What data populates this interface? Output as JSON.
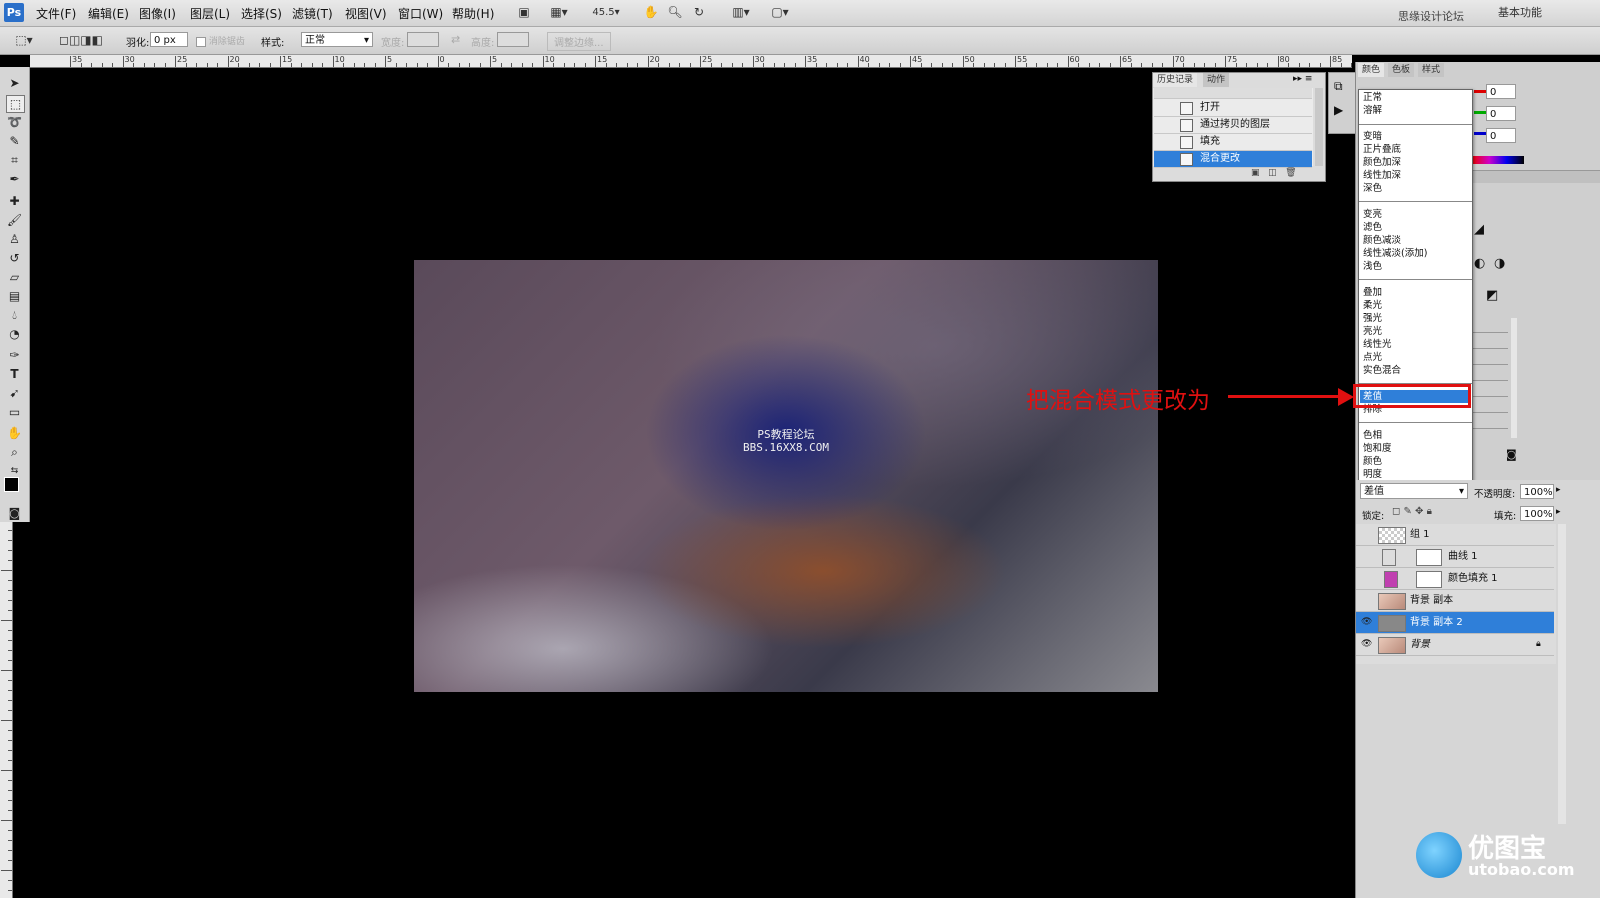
{
  "app": {
    "logo": "Ps"
  },
  "menubar": {
    "items": [
      "文件(F)",
      "编辑(E)",
      "图像(I)",
      "图层(L)",
      "选择(S)",
      "滤镜(T)",
      "视图(V)",
      "窗口(W)",
      "帮助(H)"
    ],
    "zoom": "45.5",
    "right_text": "思缘设计论坛",
    "workspace": "基本功能"
  },
  "options": {
    "feather_label": "羽化:",
    "feather_value": "0 px",
    "antialias_label": "消除锯齿",
    "style_label": "样式:",
    "style_value": "正常",
    "width_label": "宽度:",
    "height_label": "高度:",
    "refine_edge": "调整边缘..."
  },
  "ruler": {
    "labels": [
      "35",
      "30",
      "25",
      "20",
      "15",
      "10",
      "5",
      "0",
      "5",
      "10",
      "15",
      "20",
      "25",
      "30",
      "35",
      "40",
      "45",
      "50",
      "55",
      "60",
      "65",
      "70",
      "75",
      "80",
      "85"
    ]
  },
  "canvas": {
    "watermark_line1": "PS教程论坛",
    "watermark_line2": "BBS.16XX8.COM"
  },
  "annotation": {
    "text": "把混合模式更改为"
  },
  "history": {
    "tabs": [
      "历史记录",
      "动作"
    ],
    "items": [
      "打开",
      "通过拷贝的图层",
      "填充",
      "混合更改"
    ],
    "selected_index": 3
  },
  "color_panel": {
    "tabs": [
      "颜色",
      "色板",
      "样式"
    ],
    "r": "0",
    "g": "0",
    "b": "0"
  },
  "blend_menu": {
    "groups": [
      [
        "正常",
        "溶解"
      ],
      [
        "变暗",
        "正片叠底",
        "颜色加深",
        "线性加深",
        "深色"
      ],
      [
        "变亮",
        "滤色",
        "颜色减淡",
        "线性减淡(添加)",
        "浅色"
      ],
      [
        "叠加",
        "柔光",
        "强光",
        "亮光",
        "线性光",
        "点光",
        "实色混合"
      ],
      [
        "差值",
        "排除"
      ],
      [
        "色相",
        "饱和度",
        "颜色",
        "明度"
      ]
    ],
    "selected": "差值"
  },
  "layers": {
    "blend_mode": "差值",
    "opacity_label": "不透明度:",
    "opacity_value": "100%",
    "lock_label": "锁定:",
    "fill_label": "填充:",
    "fill_value": "100%",
    "items": [
      {
        "name": "组 1",
        "visible": false
      },
      {
        "name": "曲线 1",
        "visible": false
      },
      {
        "name": "颜色填充 1",
        "visible": false
      },
      {
        "name": "背景 副本",
        "visible": false
      },
      {
        "name": "背景 副本 2",
        "visible": true
      },
      {
        "name": "背景",
        "visible": true
      }
    ],
    "selected_index": 4
  },
  "branding": {
    "name": "优图宝",
    "url": "utobao.com"
  },
  "colors": {
    "accent": "#2f7fd9",
    "annotation": "#e01010"
  }
}
